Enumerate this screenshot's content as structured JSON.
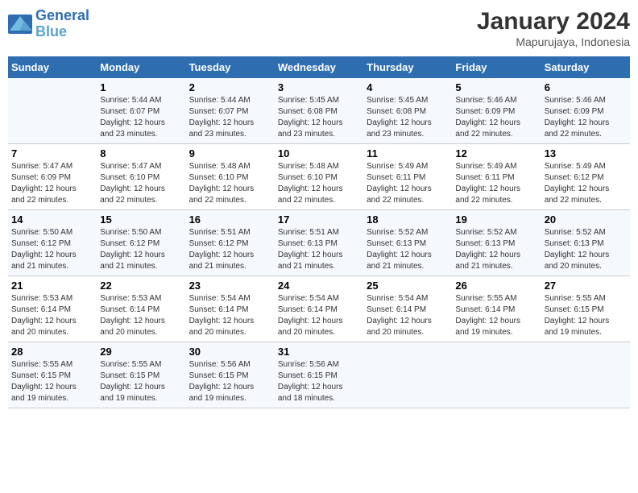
{
  "logo": {
    "line1": "General",
    "line2": "Blue"
  },
  "title": "January 2024",
  "subtitle": "Mapurujaya, Indonesia",
  "weekdays": [
    "Sunday",
    "Monday",
    "Tuesday",
    "Wednesday",
    "Thursday",
    "Friday",
    "Saturday"
  ],
  "weeks": [
    [
      {
        "num": "",
        "sunrise": "",
        "sunset": "",
        "daylight": ""
      },
      {
        "num": "1",
        "sunrise": "Sunrise: 5:44 AM",
        "sunset": "Sunset: 6:07 PM",
        "daylight": "Daylight: 12 hours and 23 minutes."
      },
      {
        "num": "2",
        "sunrise": "Sunrise: 5:44 AM",
        "sunset": "Sunset: 6:07 PM",
        "daylight": "Daylight: 12 hours and 23 minutes."
      },
      {
        "num": "3",
        "sunrise": "Sunrise: 5:45 AM",
        "sunset": "Sunset: 6:08 PM",
        "daylight": "Daylight: 12 hours and 23 minutes."
      },
      {
        "num": "4",
        "sunrise": "Sunrise: 5:45 AM",
        "sunset": "Sunset: 6:08 PM",
        "daylight": "Daylight: 12 hours and 23 minutes."
      },
      {
        "num": "5",
        "sunrise": "Sunrise: 5:46 AM",
        "sunset": "Sunset: 6:09 PM",
        "daylight": "Daylight: 12 hours and 22 minutes."
      },
      {
        "num": "6",
        "sunrise": "Sunrise: 5:46 AM",
        "sunset": "Sunset: 6:09 PM",
        "daylight": "Daylight: 12 hours and 22 minutes."
      }
    ],
    [
      {
        "num": "7",
        "sunrise": "Sunrise: 5:47 AM",
        "sunset": "Sunset: 6:09 PM",
        "daylight": "Daylight: 12 hours and 22 minutes."
      },
      {
        "num": "8",
        "sunrise": "Sunrise: 5:47 AM",
        "sunset": "Sunset: 6:10 PM",
        "daylight": "Daylight: 12 hours and 22 minutes."
      },
      {
        "num": "9",
        "sunrise": "Sunrise: 5:48 AM",
        "sunset": "Sunset: 6:10 PM",
        "daylight": "Daylight: 12 hours and 22 minutes."
      },
      {
        "num": "10",
        "sunrise": "Sunrise: 5:48 AM",
        "sunset": "Sunset: 6:10 PM",
        "daylight": "Daylight: 12 hours and 22 minutes."
      },
      {
        "num": "11",
        "sunrise": "Sunrise: 5:49 AM",
        "sunset": "Sunset: 6:11 PM",
        "daylight": "Daylight: 12 hours and 22 minutes."
      },
      {
        "num": "12",
        "sunrise": "Sunrise: 5:49 AM",
        "sunset": "Sunset: 6:11 PM",
        "daylight": "Daylight: 12 hours and 22 minutes."
      },
      {
        "num": "13",
        "sunrise": "Sunrise: 5:49 AM",
        "sunset": "Sunset: 6:12 PM",
        "daylight": "Daylight: 12 hours and 22 minutes."
      }
    ],
    [
      {
        "num": "14",
        "sunrise": "Sunrise: 5:50 AM",
        "sunset": "Sunset: 6:12 PM",
        "daylight": "Daylight: 12 hours and 21 minutes."
      },
      {
        "num": "15",
        "sunrise": "Sunrise: 5:50 AM",
        "sunset": "Sunset: 6:12 PM",
        "daylight": "Daylight: 12 hours and 21 minutes."
      },
      {
        "num": "16",
        "sunrise": "Sunrise: 5:51 AM",
        "sunset": "Sunset: 6:12 PM",
        "daylight": "Daylight: 12 hours and 21 minutes."
      },
      {
        "num": "17",
        "sunrise": "Sunrise: 5:51 AM",
        "sunset": "Sunset: 6:13 PM",
        "daylight": "Daylight: 12 hours and 21 minutes."
      },
      {
        "num": "18",
        "sunrise": "Sunrise: 5:52 AM",
        "sunset": "Sunset: 6:13 PM",
        "daylight": "Daylight: 12 hours and 21 minutes."
      },
      {
        "num": "19",
        "sunrise": "Sunrise: 5:52 AM",
        "sunset": "Sunset: 6:13 PM",
        "daylight": "Daylight: 12 hours and 21 minutes."
      },
      {
        "num": "20",
        "sunrise": "Sunrise: 5:52 AM",
        "sunset": "Sunset: 6:13 PM",
        "daylight": "Daylight: 12 hours and 20 minutes."
      }
    ],
    [
      {
        "num": "21",
        "sunrise": "Sunrise: 5:53 AM",
        "sunset": "Sunset: 6:14 PM",
        "daylight": "Daylight: 12 hours and 20 minutes."
      },
      {
        "num": "22",
        "sunrise": "Sunrise: 5:53 AM",
        "sunset": "Sunset: 6:14 PM",
        "daylight": "Daylight: 12 hours and 20 minutes."
      },
      {
        "num": "23",
        "sunrise": "Sunrise: 5:54 AM",
        "sunset": "Sunset: 6:14 PM",
        "daylight": "Daylight: 12 hours and 20 minutes."
      },
      {
        "num": "24",
        "sunrise": "Sunrise: 5:54 AM",
        "sunset": "Sunset: 6:14 PM",
        "daylight": "Daylight: 12 hours and 20 minutes."
      },
      {
        "num": "25",
        "sunrise": "Sunrise: 5:54 AM",
        "sunset": "Sunset: 6:14 PM",
        "daylight": "Daylight: 12 hours and 20 minutes."
      },
      {
        "num": "26",
        "sunrise": "Sunrise: 5:55 AM",
        "sunset": "Sunset: 6:14 PM",
        "daylight": "Daylight: 12 hours and 19 minutes."
      },
      {
        "num": "27",
        "sunrise": "Sunrise: 5:55 AM",
        "sunset": "Sunset: 6:15 PM",
        "daylight": "Daylight: 12 hours and 19 minutes."
      }
    ],
    [
      {
        "num": "28",
        "sunrise": "Sunrise: 5:55 AM",
        "sunset": "Sunset: 6:15 PM",
        "daylight": "Daylight: 12 hours and 19 minutes."
      },
      {
        "num": "29",
        "sunrise": "Sunrise: 5:55 AM",
        "sunset": "Sunset: 6:15 PM",
        "daylight": "Daylight: 12 hours and 19 minutes."
      },
      {
        "num": "30",
        "sunrise": "Sunrise: 5:56 AM",
        "sunset": "Sunset: 6:15 PM",
        "daylight": "Daylight: 12 hours and 19 minutes."
      },
      {
        "num": "31",
        "sunrise": "Sunrise: 5:56 AM",
        "sunset": "Sunset: 6:15 PM",
        "daylight": "Daylight: 12 hours and 18 minutes."
      },
      {
        "num": "",
        "sunrise": "",
        "sunset": "",
        "daylight": ""
      },
      {
        "num": "",
        "sunrise": "",
        "sunset": "",
        "daylight": ""
      },
      {
        "num": "",
        "sunrise": "",
        "sunset": "",
        "daylight": ""
      }
    ]
  ]
}
